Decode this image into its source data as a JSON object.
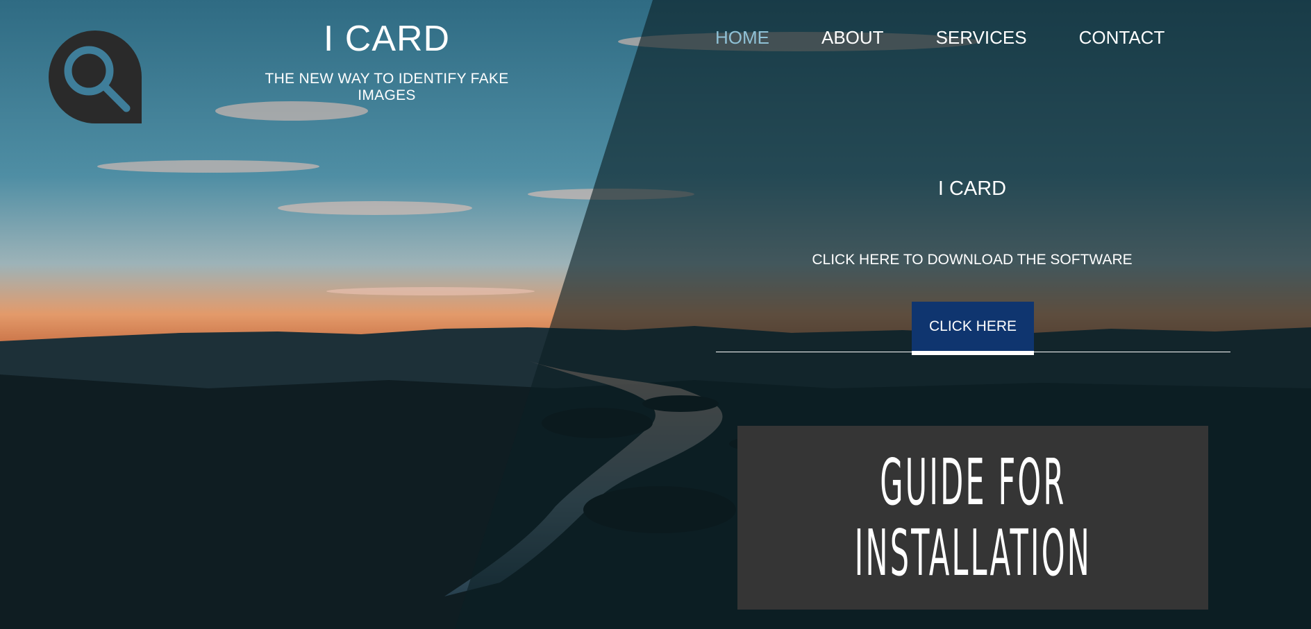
{
  "brand": {
    "title": "I CARD",
    "tagline": "THE NEW WAY TO IDENTIFY FAKE IMAGES",
    "logo_icon": "search-icon"
  },
  "nav": {
    "items": [
      {
        "label": "HOME",
        "active": true
      },
      {
        "label": "ABOUT",
        "active": false
      },
      {
        "label": "SERVICES",
        "active": false
      },
      {
        "label": "CONTACT",
        "active": false
      }
    ]
  },
  "hero": {
    "title": "I CARD",
    "subtitle": "CLICK HERE TO DOWNLOAD THE SOFTWARE",
    "button_label": "CLICK HERE"
  },
  "guide": {
    "line1": "GUIDE FOR",
    "line2": "INSTALLATION"
  },
  "colors": {
    "nav_active": "#8fc1d6",
    "cta_background": "#0f356f",
    "guide_background": "#353535",
    "logo": "#2a2a2a"
  }
}
